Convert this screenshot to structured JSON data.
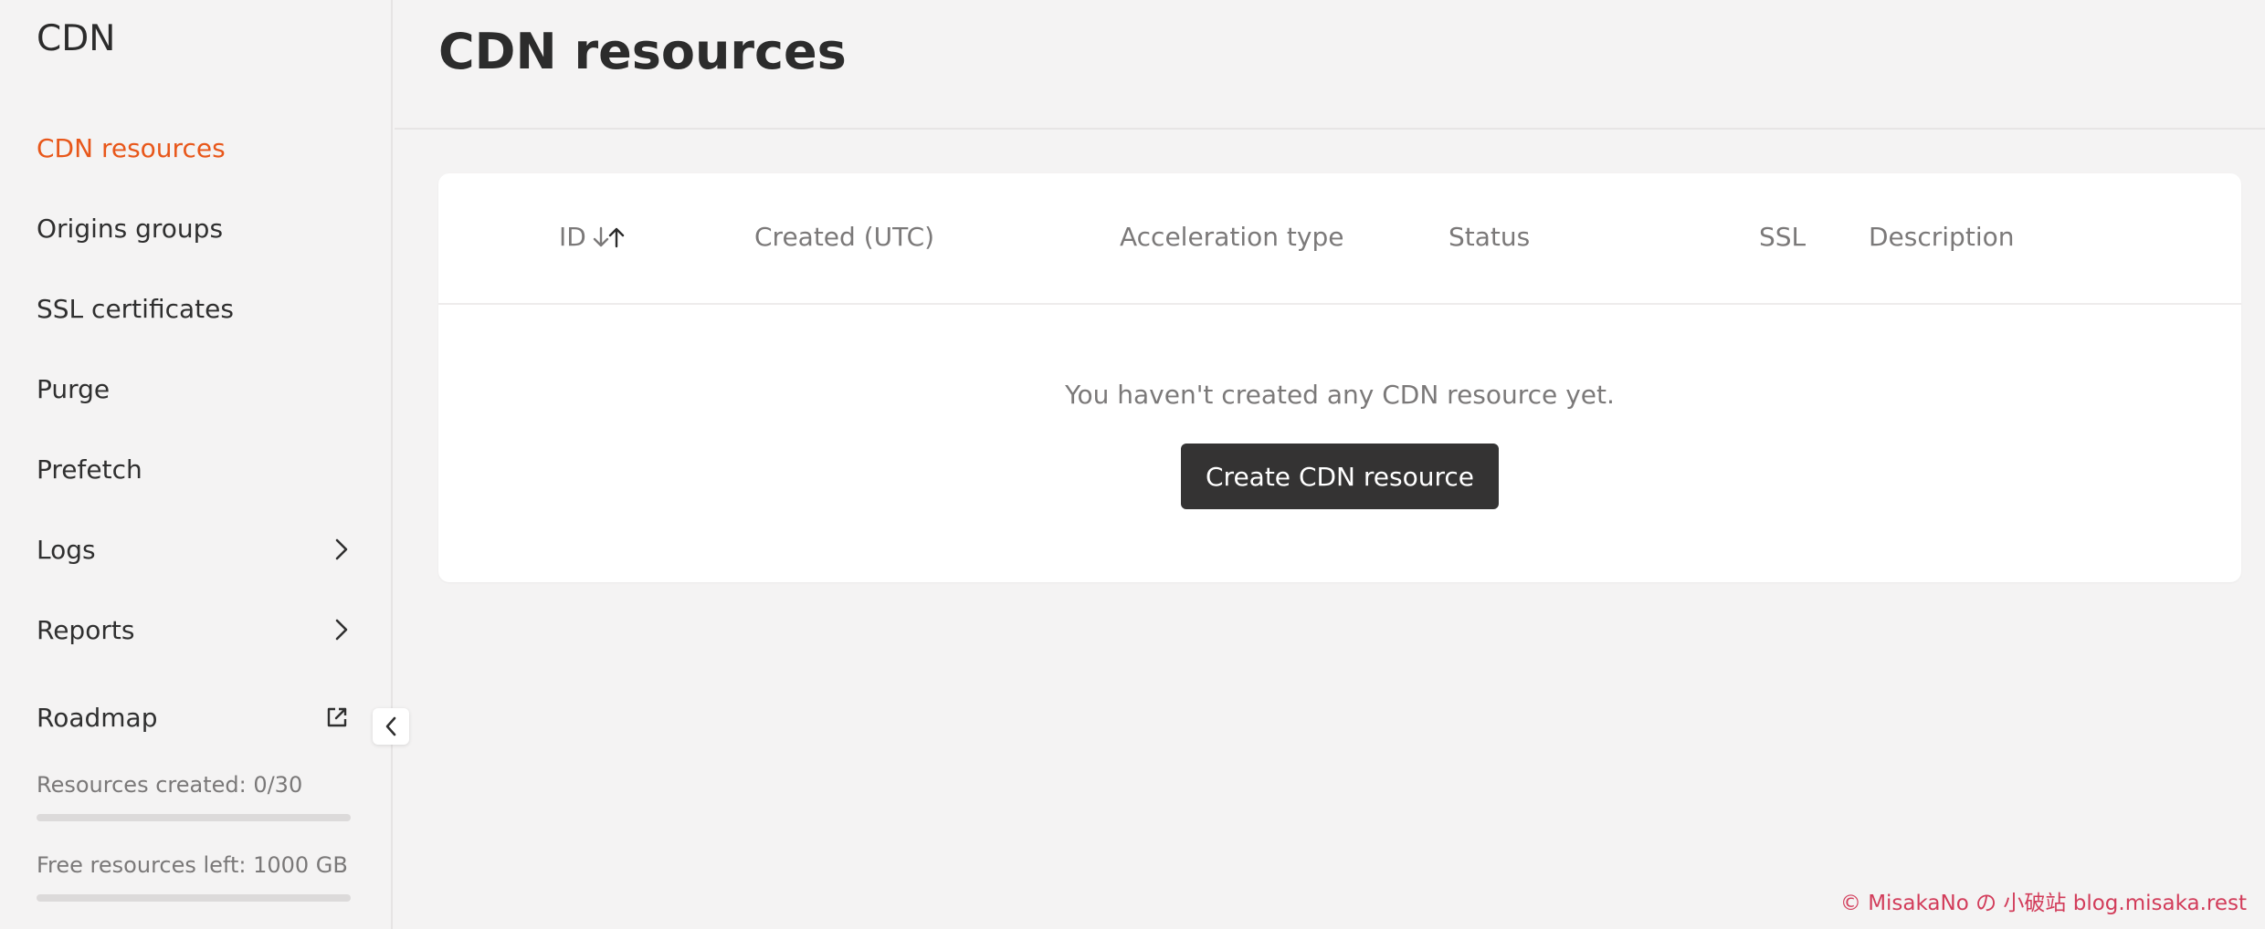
{
  "sidebar": {
    "title": "CDN",
    "items": [
      {
        "label": "CDN resources"
      },
      {
        "label": "Origins groups"
      },
      {
        "label": "SSL certificates"
      },
      {
        "label": "Purge"
      },
      {
        "label": "Prefetch"
      },
      {
        "label": "Logs",
        "icon": "chevron-right-icon"
      },
      {
        "label": "Reports",
        "icon": "chevron-right-icon"
      },
      {
        "label": "Roadmap",
        "icon": "external-link-icon"
      }
    ],
    "resources_created": {
      "label": "Resources created: 0/30",
      "progress": 0
    },
    "free_resources": {
      "label": "Free resources left: 1000 GB",
      "progress": 0
    },
    "collapse_icon": "chevron-left-icon"
  },
  "main": {
    "title": "CDN resources",
    "table": {
      "columns": [
        "ID",
        "Created (UTC)",
        "Acceleration type",
        "Status",
        "SSL",
        "Description"
      ],
      "sort_icon": "sort-arrows-icon"
    },
    "empty_message": "You haven't created any CDN resource yet.",
    "create_button": "Create CDN resource"
  },
  "watermark": "© MisakaNo の 小破站 blog.misaka.rest",
  "colors": {
    "accent": "#e8571a",
    "button_bg": "#343333",
    "page_bg": "#f4f3f3",
    "watermark": "#d23c5a"
  }
}
